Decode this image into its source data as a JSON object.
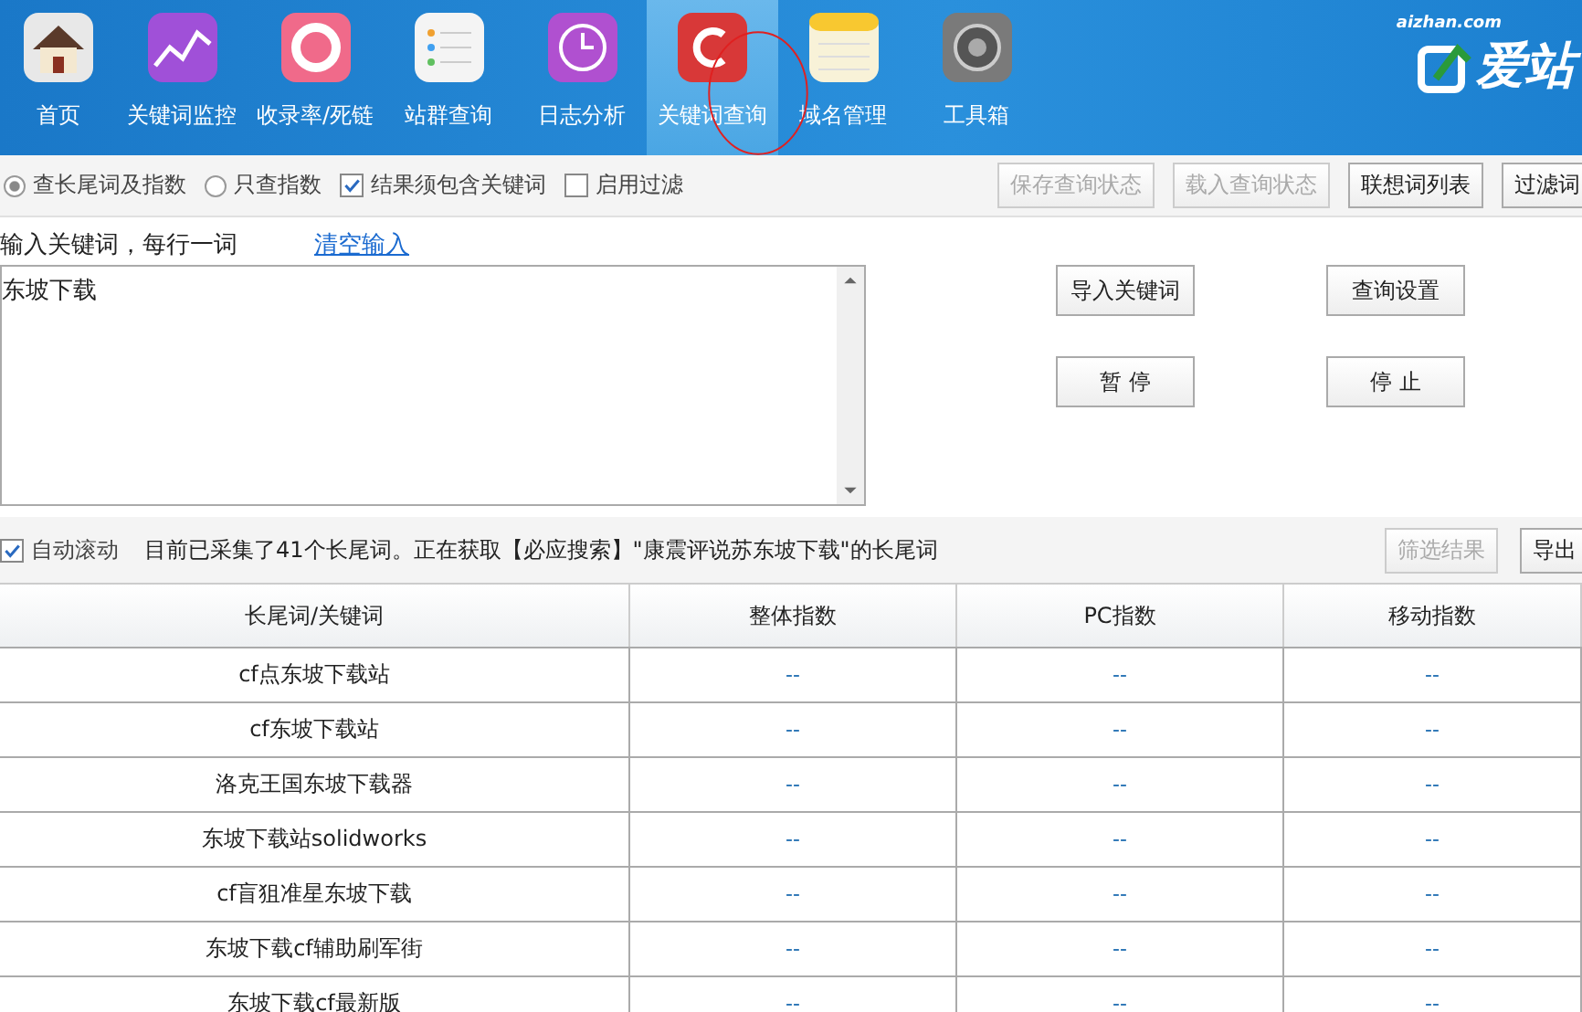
{
  "nav": {
    "items": [
      {
        "label": "首页",
        "selected": false
      },
      {
        "label": "关键词监控",
        "selected": false
      },
      {
        "label": "收录率/死链",
        "selected": false
      },
      {
        "label": "站群查询",
        "selected": false
      },
      {
        "label": "日志分析",
        "selected": false
      },
      {
        "label": "关键词查询",
        "selected": true
      },
      {
        "label": "域名管理",
        "selected": false
      },
      {
        "label": "工具箱",
        "selected": false
      }
    ],
    "logo": {
      "domain": "aizhan.com",
      "name": "爱站"
    }
  },
  "options": {
    "modes": [
      {
        "label": "查长尾词及指数",
        "selected": true
      },
      {
        "label": "只查指数",
        "selected": false
      }
    ],
    "checks": [
      {
        "label": "结果须包含关键词",
        "checked": true
      },
      {
        "label": "启用过滤",
        "checked": false
      }
    ],
    "buttons": [
      {
        "label": "保存查询状态",
        "disabled": true
      },
      {
        "label": "载入查询状态",
        "disabled": true
      },
      {
        "label": "联想词列表",
        "disabled": false
      },
      {
        "label": "过滤词",
        "disabled": false
      }
    ]
  },
  "input": {
    "label": "输入关键词，每行一词",
    "clear_link": "清空输入",
    "value": "东坡下载",
    "buttons": [
      {
        "label": "导入关键词"
      },
      {
        "label": "查询设置"
      },
      {
        "label": "暂 停"
      },
      {
        "label": "停 止"
      }
    ]
  },
  "status": {
    "auto_scroll": {
      "label": "自动滚动",
      "checked": true
    },
    "message": "目前已采集了41个长尾词。正在获取【必应搜索】\"康震评说苏东坡下载\"的长尾词",
    "buttons": [
      {
        "label": "筛选结果",
        "disabled": true
      },
      {
        "label": "导出",
        "disabled": false
      }
    ]
  },
  "table": {
    "columns": [
      "长尾词/关键词",
      "整体指数",
      "PC指数",
      "移动指数"
    ],
    "rows": [
      [
        "cf点东坡下载站",
        "--",
        "--",
        "--"
      ],
      [
        "cf东坡下载站",
        "--",
        "--",
        "--"
      ],
      [
        "洛克王国东坡下载器",
        "--",
        "--",
        "--"
      ],
      [
        "东坡下载站solidworks",
        "--",
        "--",
        "--"
      ],
      [
        "cf盲狙准星东坡下载",
        "--",
        "--",
        "--"
      ],
      [
        "东坡下载cf辅助刷军街",
        "--",
        "--",
        "--"
      ],
      [
        "东坡下载cf最新版",
        "--",
        "--",
        "--"
      ]
    ]
  }
}
